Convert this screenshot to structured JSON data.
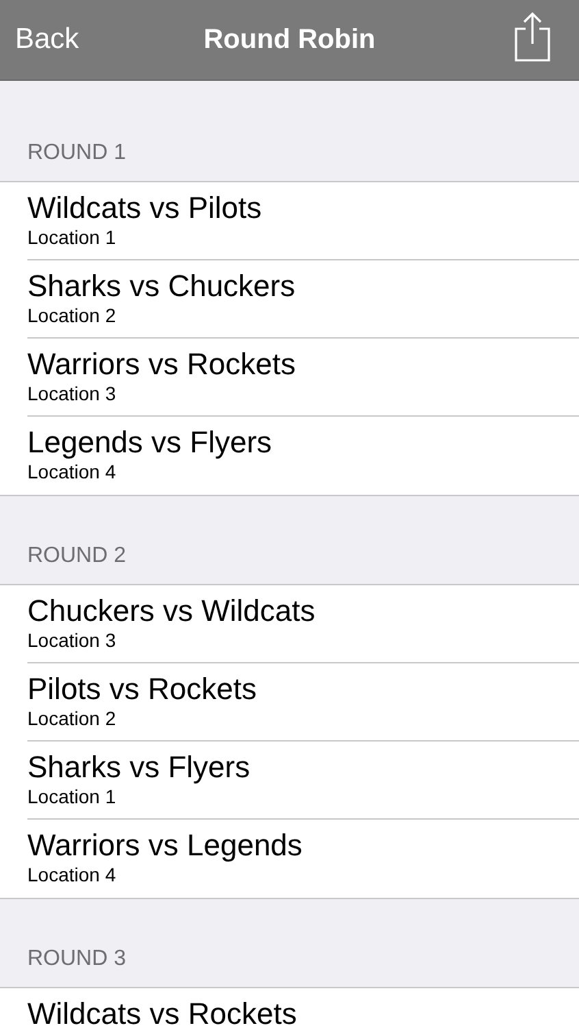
{
  "nav_bar": {
    "back": "Back",
    "title": "Round Robin"
  },
  "rounds": [
    {
      "title": "ROUND 1",
      "matches": [
        {
          "teams": "Wildcats vs Pilots",
          "location": "Location 1"
        },
        {
          "teams": "Sharks vs Chuckers",
          "location": "Location 2"
        },
        {
          "teams": "Warriors vs Rockets",
          "location": "Location 3"
        },
        {
          "teams": "Legends vs Flyers",
          "location": "Location 4"
        }
      ]
    },
    {
      "title": "ROUND 2",
      "matches": [
        {
          "teams": "Chuckers vs Wildcats",
          "location": "Location 3"
        },
        {
          "teams": "Pilots vs Rockets",
          "location": "Location 2"
        },
        {
          "teams": "Sharks vs Flyers",
          "location": "Location 1"
        },
        {
          "teams": "Warriors vs Legends",
          "location": "Location 4"
        }
      ]
    },
    {
      "title": "ROUND 3",
      "matches": [
        {
          "teams": "Wildcats vs Rockets"
        }
      ]
    }
  ]
}
